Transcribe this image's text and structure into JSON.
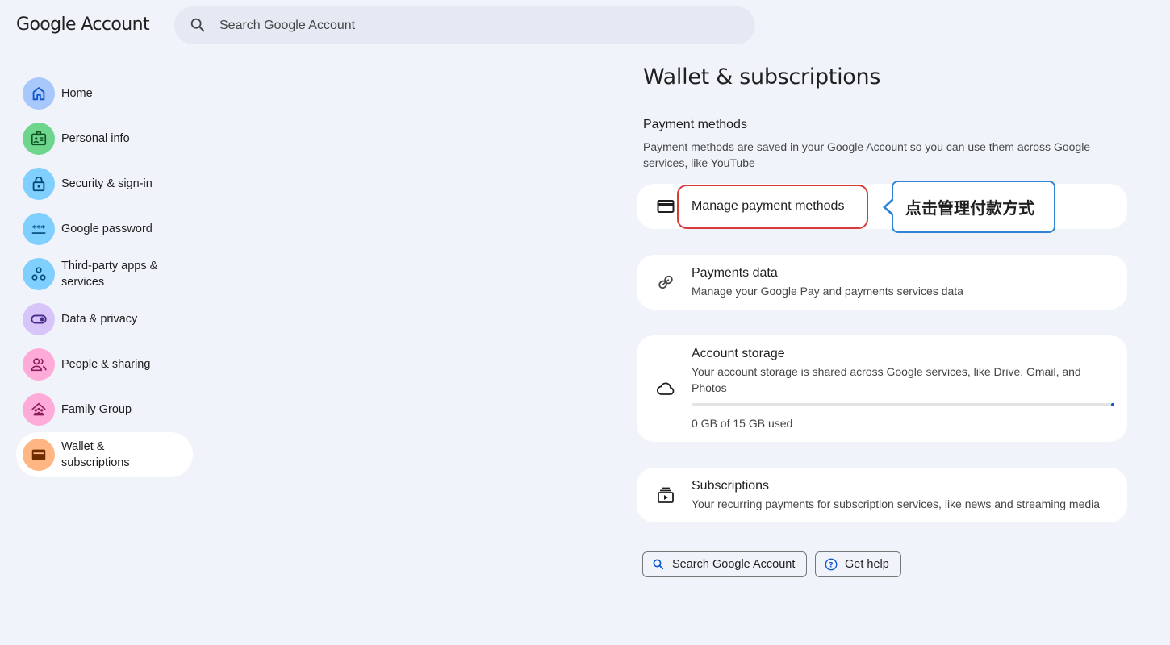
{
  "header": {
    "logo": "Google Account",
    "search_placeholder": "Search Google Account"
  },
  "sidebar": {
    "items": [
      {
        "label": "Home",
        "icon": "home-icon",
        "bg": "#a8c7fa",
        "color": "#0b57d0"
      },
      {
        "label": "Personal info",
        "icon": "id-card-icon",
        "bg": "#6dd58c",
        "color": "#0f5223"
      },
      {
        "label": "Security & sign-in",
        "icon": "lock-icon",
        "bg": "#7fcfff",
        "color": "#004a77"
      },
      {
        "label": "Google password",
        "icon": "password-icon",
        "bg": "#7fcfff",
        "color": "#004a77"
      },
      {
        "label": "Third-party apps & services",
        "icon": "apps-icon",
        "bg": "#7fcfff",
        "color": "#004a77"
      },
      {
        "label": "Data & privacy",
        "icon": "toggle-icon",
        "bg": "#d7c5fa",
        "color": "#4a2a8c"
      },
      {
        "label": "People & sharing",
        "icon": "people-icon",
        "bg": "#ffabd9",
        "color": "#8a1e5c"
      },
      {
        "label": "Family Group",
        "icon": "family-icon",
        "bg": "#ffabd9",
        "color": "#8a1e5c"
      },
      {
        "label": "Wallet & subscriptions",
        "icon": "wallet-icon",
        "bg": "#ffb683",
        "color": "#6e2c00"
      }
    ],
    "active_index": 8
  },
  "main": {
    "title": "Wallet & subscriptions",
    "payment_section_title": "Payment methods",
    "payment_section_desc": "Payment methods are saved in your Google Account so you can use them across Google services, like YouTube",
    "manage_payment": {
      "title": "Manage payment methods",
      "icon": "credit-card-icon"
    },
    "callout_text": "点击管理付款方式",
    "payments_data": {
      "title": "Payments data",
      "subtitle": "Manage your Google Pay and payments services data",
      "icon": "payments-data-icon"
    },
    "account_storage": {
      "title": "Account storage",
      "subtitle": "Your account storage is shared across Google services, like Drive, Gmail, and Photos",
      "usage_text": "0 GB of 15 GB used",
      "usage_fraction": 0,
      "icon": "cloud-icon"
    },
    "subscriptions": {
      "title": "Subscriptions",
      "subtitle": "Your recurring payments for subscription services, like news and streaming media",
      "icon": "subscriptions-icon"
    }
  },
  "footer": {
    "search_label": "Search Google Account",
    "help_label": "Get help"
  },
  "colors": {
    "background": "#f0f3f9",
    "card": "#ffffff",
    "accent": "#0b57d0",
    "highlight_box": "#d93a3a",
    "callout_border": "#2f86d6"
  }
}
